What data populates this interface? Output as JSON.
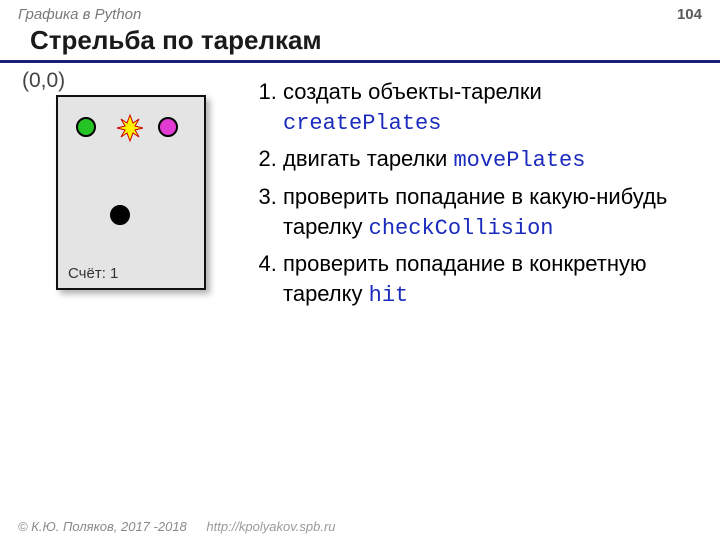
{
  "header": {
    "section": "Графика в Python",
    "page": "104"
  },
  "title": "Стрельба по тарелкам",
  "coord_label": "(0,0)",
  "game": {
    "score_label": "Счёт: 1"
  },
  "steps": [
    {
      "text": "создать объекты-тарелки",
      "code": "createPlates"
    },
    {
      "text": "двигать тарелки",
      "code": "movePlates"
    },
    {
      "text": "проверить попадание в какую-нибудь тарелку",
      "code": "checkCollision"
    },
    {
      "text": "проверить попадание в конкретную тарелку",
      "code": "hit"
    }
  ],
  "footer": {
    "copyright": "© К.Ю. Поляков, 2017 -2018",
    "url": "http://kpolyakov.spb.ru"
  }
}
